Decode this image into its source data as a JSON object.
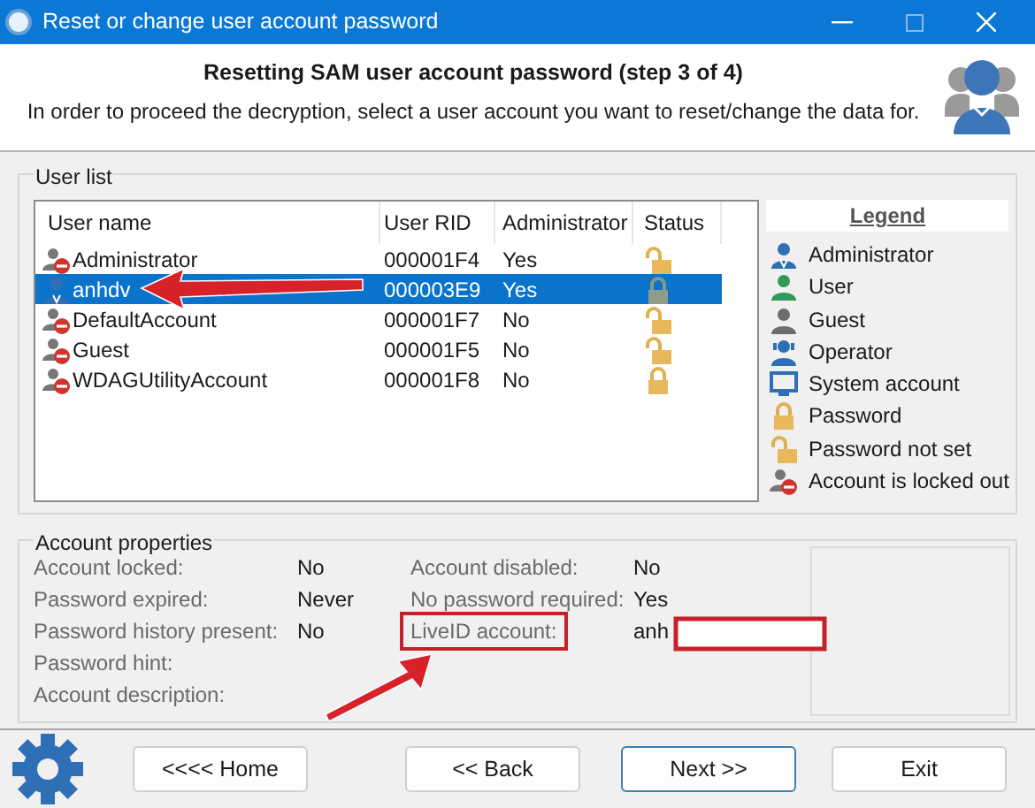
{
  "window": {
    "title": "Reset or change user account password"
  },
  "header": {
    "title": "Resetting SAM user account password (step 3 of 4)",
    "subtitle": "In order to proceed the decryption, select a user account you want to reset/change the data for."
  },
  "user_list": {
    "label": "User list",
    "columns": [
      "User name",
      "User RID",
      "Administrator",
      "Status"
    ],
    "rows": [
      {
        "name": "Administrator",
        "rid": "000001F4",
        "admin": "Yes",
        "kind": "locked_out",
        "password_set": false,
        "selected": false
      },
      {
        "name": "anhdv",
        "rid": "000003E9",
        "admin": "Yes",
        "kind": "administrator",
        "password_set": true,
        "selected": true
      },
      {
        "name": "DefaultAccount",
        "rid": "000001F7",
        "admin": "No",
        "kind": "locked_out",
        "password_set": false,
        "selected": false
      },
      {
        "name": "Guest",
        "rid": "000001F5",
        "admin": "No",
        "kind": "locked_out",
        "password_set": false,
        "selected": false
      },
      {
        "name": "WDAGUtilityAccount",
        "rid": "000001F8",
        "admin": "No",
        "kind": "locked_out",
        "password_set": true,
        "selected": false
      }
    ]
  },
  "legend": {
    "title": "Legend",
    "items": [
      {
        "label": "Administrator",
        "kind": "administrator"
      },
      {
        "label": "User",
        "kind": "user"
      },
      {
        "label": "Guest",
        "kind": "guest"
      },
      {
        "label": "Operator",
        "kind": "operator"
      },
      {
        "label": "System account",
        "kind": "system"
      },
      {
        "label": "Password",
        "kind": "password"
      },
      {
        "label": "Password not set",
        "kind": "password_not_set"
      },
      {
        "label": "Account is locked out",
        "kind": "locked_out"
      }
    ]
  },
  "account_properties": {
    "label": "Account properties",
    "fields": [
      {
        "label": "Account locked:",
        "value": "No"
      },
      {
        "label": "Account disabled:",
        "value": "No"
      },
      {
        "label": "Password expired:",
        "value": "Never"
      },
      {
        "label": "No password required:",
        "value": "Yes"
      },
      {
        "label": "Password history present:",
        "value": "No"
      },
      {
        "label": "LiveID account:",
        "value": "anh",
        "highlighted": true
      },
      {
        "label": "Password hint:"
      },
      {
        "label": "Account description:"
      }
    ]
  },
  "buttons": [
    "<<<< Home",
    "<< Back",
    "Next >>",
    "Exit"
  ]
}
